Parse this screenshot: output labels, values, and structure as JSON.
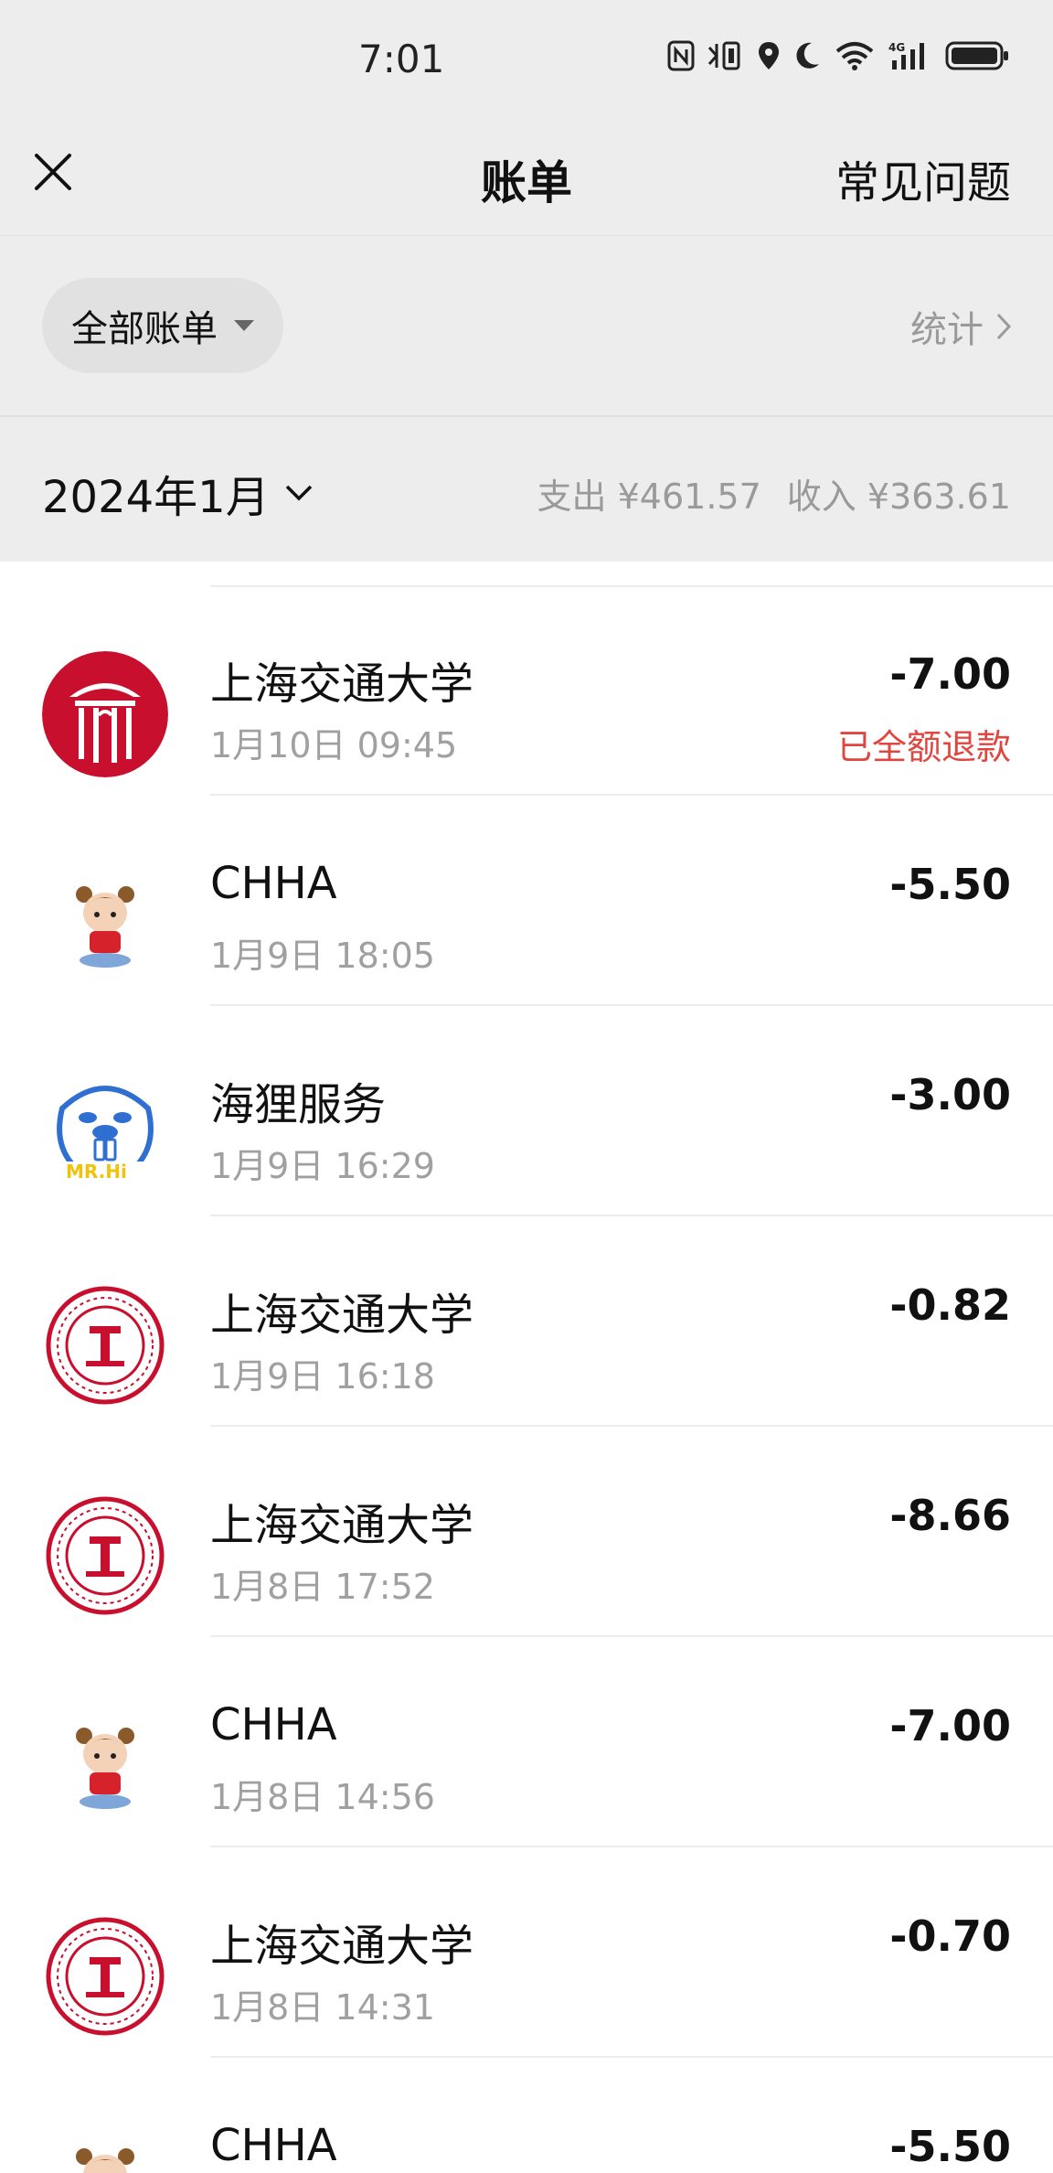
{
  "status_bar": {
    "time": "7:01",
    "icons": [
      "nfc-icon",
      "vibrate-icon",
      "location-icon",
      "moon-icon",
      "wifi-icon",
      "cellular-4g-icon",
      "battery-icon"
    ]
  },
  "nav": {
    "title": "账单",
    "faq_label": "常见问题",
    "close_icon": "close-icon"
  },
  "filter": {
    "selected": "全部账单",
    "stats_label": "统计"
  },
  "month": {
    "label": "2024年1月",
    "expense": "支出 ¥461.57",
    "income": "收入 ¥363.61"
  },
  "transactions": [
    {
      "merchant": "上海交通大学",
      "datetime": "1月10日 09:45",
      "amount": "-7.00",
      "note": "已全额退款",
      "avatar": "sjtu-gate-logo"
    },
    {
      "merchant": "CHHA",
      "datetime": "1月9日 18:05",
      "amount": "-5.50",
      "note": "",
      "avatar": "girl-avatar"
    },
    {
      "merchant": "海狸服务",
      "datetime": "1月9日 16:29",
      "amount": "-3.00",
      "note": "",
      "avatar": "beaver-avatar"
    },
    {
      "merchant": "上海交通大学",
      "datetime": "1月9日 16:18",
      "amount": "-0.82",
      "note": "",
      "avatar": "sjtu-seal-logo"
    },
    {
      "merchant": "上海交通大学",
      "datetime": "1月8日 17:52",
      "amount": "-8.66",
      "note": "",
      "avatar": "sjtu-seal-logo"
    },
    {
      "merchant": "CHHA",
      "datetime": "1月8日 14:56",
      "amount": "-7.00",
      "note": "",
      "avatar": "girl-avatar"
    },
    {
      "merchant": "上海交通大学",
      "datetime": "1月8日 14:31",
      "amount": "-0.70",
      "note": "",
      "avatar": "sjtu-seal-logo"
    },
    {
      "merchant": "CHHA",
      "datetime": "",
      "amount": "-5.50",
      "note": "",
      "avatar": "girl-avatar"
    }
  ],
  "colors": {
    "background": "#ededed",
    "refund_red": "#e0463f",
    "sjtu_red": "#c8102e",
    "muted": "#a0a0a0"
  }
}
